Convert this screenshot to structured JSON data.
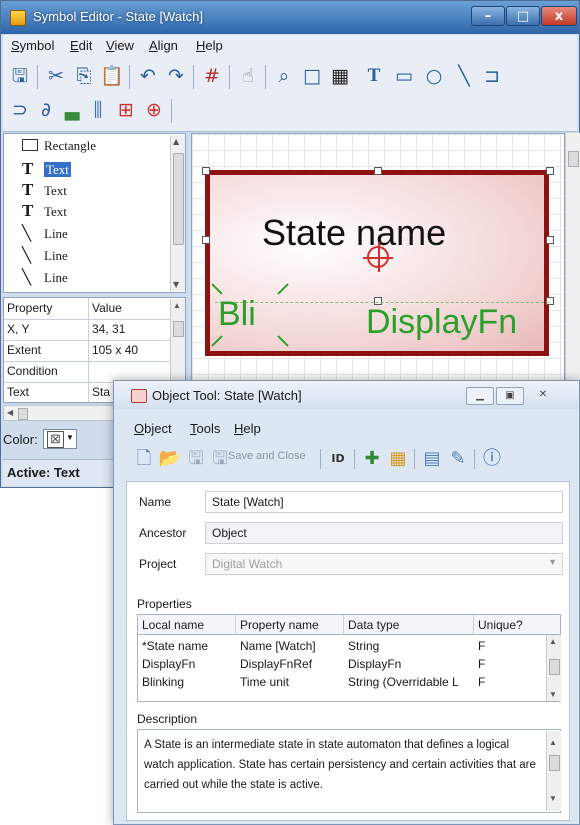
{
  "symbol_editor": {
    "title": "Symbol Editor - State [Watch]",
    "menu": [
      "Symbol",
      "Edit",
      "View",
      "Align",
      "Help"
    ],
    "palette_items": [
      {
        "label": "Rectangle",
        "icon": "rectangle-icon"
      },
      {
        "label": "Text",
        "icon": "text-icon",
        "selected": true
      },
      {
        "label": "Text",
        "icon": "text-icon"
      },
      {
        "label": "Text",
        "icon": "text-icon"
      },
      {
        "label": "Line",
        "icon": "line-icon"
      },
      {
        "label": "Line",
        "icon": "line-icon"
      },
      {
        "label": "Line",
        "icon": "line-icon"
      }
    ],
    "property_grid": {
      "headers": [
        "Property",
        "Value"
      ],
      "rows": [
        {
          "key": "X, Y",
          "value": "34, 31"
        },
        {
          "key": "Extent",
          "value": "105 x 40"
        },
        {
          "key": "Condition",
          "value": ""
        },
        {
          "key": "Text",
          "value": "Sta"
        }
      ]
    },
    "color_label": "Color:",
    "status": "Active: Text",
    "canvas": {
      "state_name": "State name",
      "blink_text": "Bli",
      "display_text": "DisplayFn",
      "frame_color": "#8e1212",
      "text_color_green": "#2aa02a"
    }
  },
  "object_tool": {
    "title": "Object Tool: State [Watch]",
    "menu": [
      "Object",
      "Tools",
      "Help"
    ],
    "toolbar": {
      "save_close": "Save and Close"
    },
    "fields": {
      "name_label": "Name",
      "name_value": "State [Watch]",
      "ancestor_label": "Ancestor",
      "ancestor_value": "Object",
      "project_label": "Project",
      "project_value": "Digital Watch"
    },
    "properties_label": "Properties",
    "table": {
      "headers": [
        "Local name",
        "Property name",
        "Data type",
        "Unique?"
      ],
      "rows": [
        [
          "*State name",
          "Name [Watch]",
          "String",
          "F"
        ],
        [
          "DisplayFn",
          "DisplayFnRef",
          "DisplayFn",
          "F"
        ],
        [
          "Blinking",
          "Time unit",
          "String (Overridable L",
          "F"
        ]
      ]
    },
    "description_label": "Description",
    "description": "A State is an intermediate state in state automaton that defines a logical watch application. State has certain persistency and certain activities that are carried out while the state is active."
  }
}
